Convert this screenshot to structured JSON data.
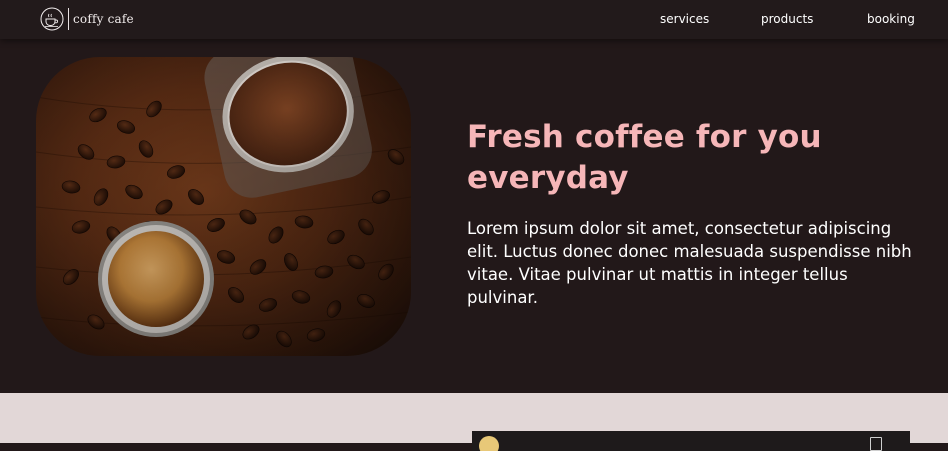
{
  "brand": {
    "name": "coffy cafe",
    "logo_icon": "coffee-cup-logo-icon"
  },
  "nav": {
    "links": [
      {
        "label": "services"
      },
      {
        "label": "products"
      },
      {
        "label": "booking"
      }
    ]
  },
  "hero": {
    "image_alt": "coffee beans, ground coffee jar and espresso cup on wooden table",
    "title": "Fresh coffee for you everyday",
    "body": "Lorem ipsum dolor sit amet, consectetur adipiscing elit. Luctus donec donec malesuada suspendisse nibh vitae. Vitae pulvinar ut mattis in integer tellus pulvinar."
  },
  "colors": {
    "background": "#221819",
    "navbar": "#221a1b",
    "title": "#f6b6b8",
    "text": "#ffffff",
    "section_below": "#e2d7d7"
  }
}
